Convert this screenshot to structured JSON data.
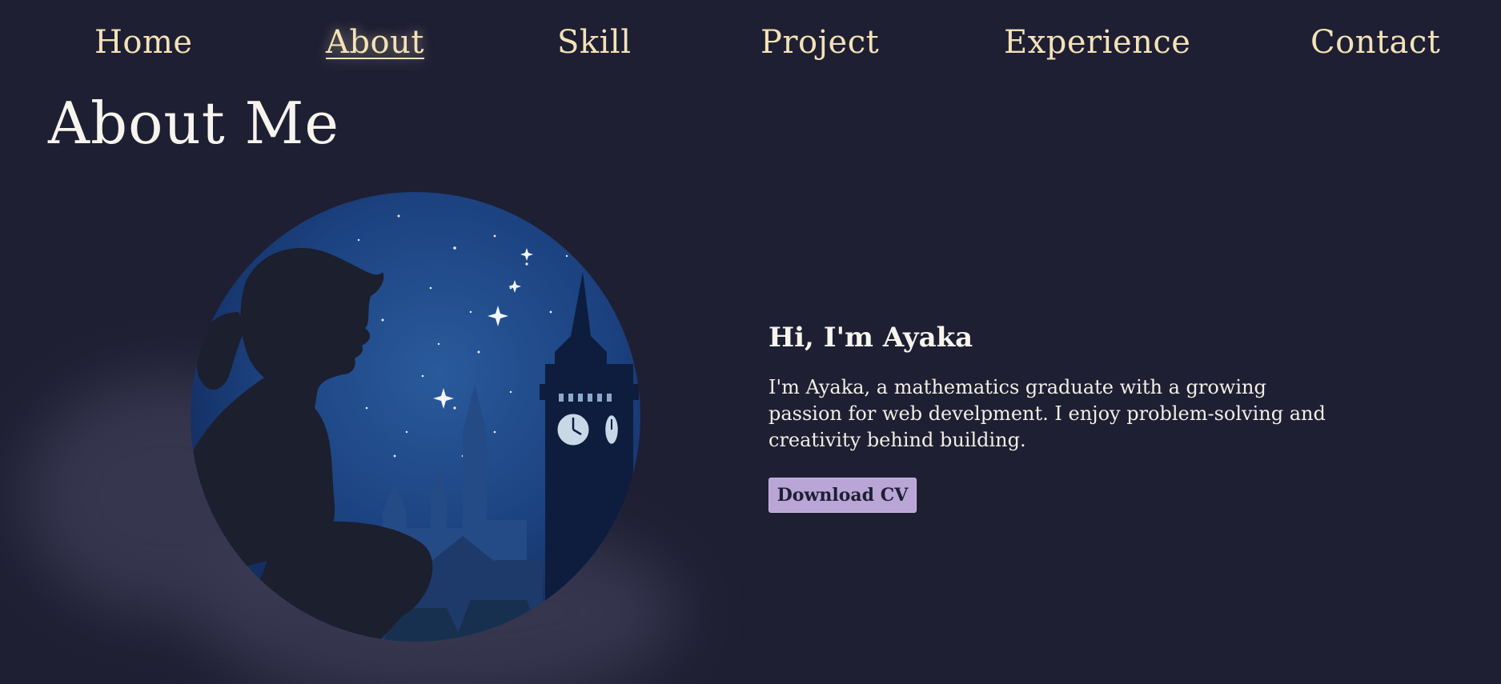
{
  "nav": {
    "items": [
      {
        "label": "Home"
      },
      {
        "label": "About"
      },
      {
        "label": "Skill"
      },
      {
        "label": "Project"
      },
      {
        "label": "Experience"
      },
      {
        "label": "Contact"
      }
    ],
    "active": "About"
  },
  "section": {
    "title": "About Me"
  },
  "intro": {
    "heading": "Hi, I'm Ayaka",
    "paragraph": "I'm Ayaka, a mathematics graduate with a growing passion for web develpment. I enjoy problem-solving and creativity behind building.",
    "button_label": "Download CV"
  },
  "colors": {
    "background": "#1e1f33",
    "nav_text": "#f3e2b8",
    "button_bg": "#b9a5d6",
    "night_sky": "#1b3d78"
  },
  "illustration": {
    "subject": "silhouette-girl-night-city-clocktower"
  }
}
